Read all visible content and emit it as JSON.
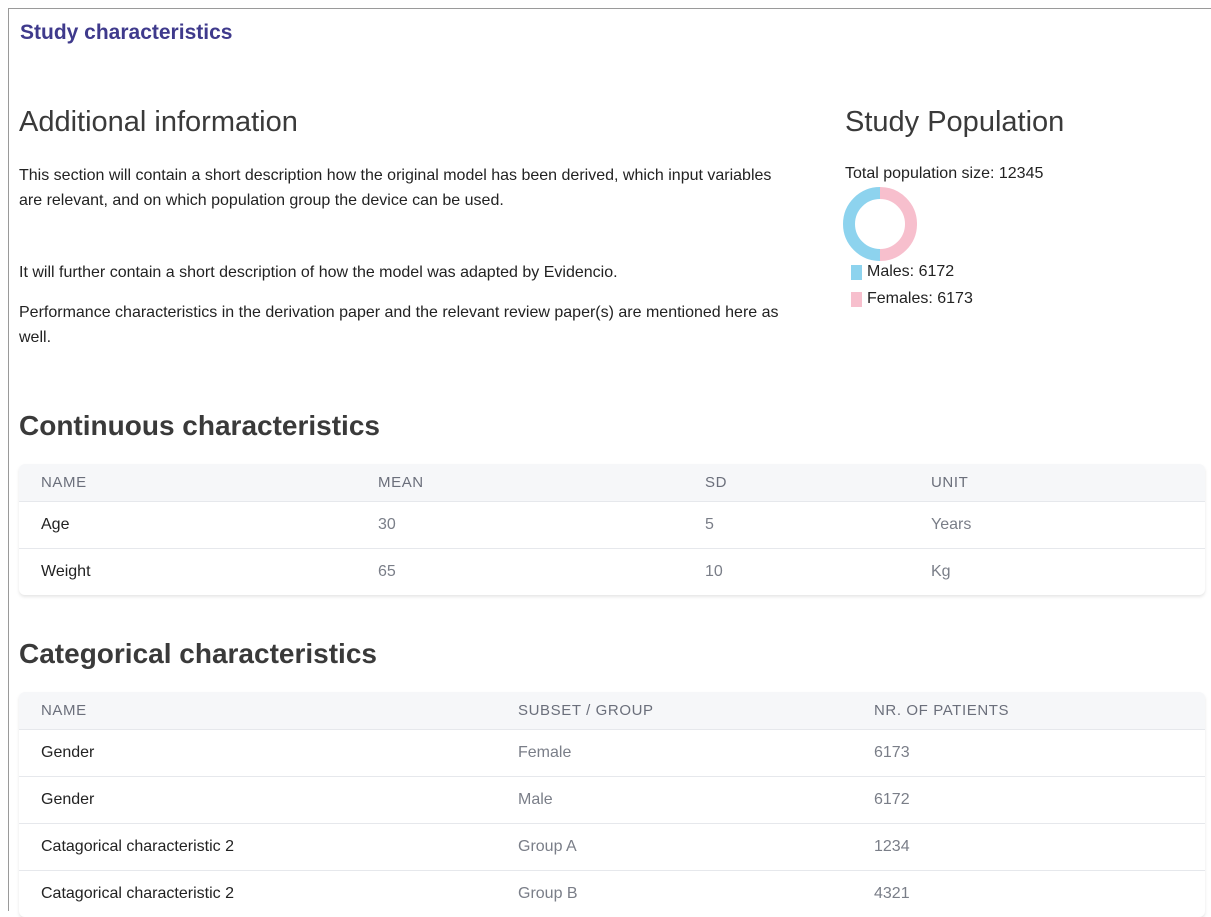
{
  "section_title": "Study characteristics",
  "additional": {
    "heading": "Additional information",
    "paragraphs": [
      "This section will contain a short description how the original model has been derived, which input variables are relevant, and on which population group the device can be used.",
      "It will further contain a short description of how the model was adapted by Evidencio.",
      "Performance characteristics in the derivation paper and the relevant review paper(s) are mentioned here as well."
    ]
  },
  "population": {
    "heading": "Study Population",
    "total_label": "Total population size: 12345",
    "colors": {
      "males": "#8dd3ee",
      "females": "#f7bfcd"
    },
    "legend": [
      {
        "label": "Males: 6172",
        "value": 6172
      },
      {
        "label": "Females: 6173",
        "value": 6173
      }
    ]
  },
  "continuous": {
    "heading": "Continuous characteristics",
    "columns": [
      "NAME",
      "MEAN",
      "SD",
      "UNIT"
    ],
    "rows": [
      [
        "Age",
        "30",
        "5",
        "Years"
      ],
      [
        "Weight",
        "65",
        "10",
        "Kg"
      ]
    ]
  },
  "categorical": {
    "heading": "Categorical characteristics",
    "columns": [
      "NAME",
      "SUBSET / GROUP",
      "NR. OF PATIENTS"
    ],
    "rows": [
      [
        "Gender",
        "Female",
        "6173"
      ],
      [
        "Gender",
        "Male",
        "6172"
      ],
      [
        "Catagorical characteristic 2",
        "Group A",
        "1234"
      ],
      [
        "Catagorical characteristic 2",
        "Group B",
        "4321"
      ]
    ]
  }
}
